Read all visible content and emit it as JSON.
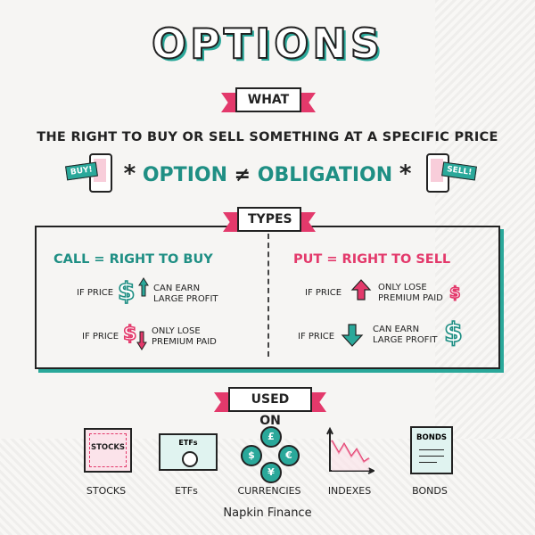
{
  "title": "OPTIONS",
  "what_ribbon": "WHAT",
  "definition": "THE RIGHT TO BUY OR SELL SOMETHING AT A SPECIFIC PRICE",
  "obligation": {
    "left": "OPTION",
    "symbol": "≠",
    "right": "OBLIGATION",
    "star": "*"
  },
  "phones": {
    "buy_tag": "BUY!",
    "sell_tag": "SELL!"
  },
  "types_ribbon": "TYPES",
  "call": {
    "heading": "CALL = RIGHT TO BUY",
    "row1": {
      "prefix": "IF PRICE",
      "dollar": "$",
      "line1": "CAN EARN",
      "line2": "LARGE PROFIT"
    },
    "row2": {
      "prefix": "IF PRICE",
      "dollar": "$",
      "line1": "ONLY LOSE",
      "line2": "PREMIUM PAID"
    }
  },
  "put": {
    "heading": "PUT = RIGHT TO SELL",
    "row1": {
      "prefix": "IF PRICE",
      "dollar": "$",
      "line1": "ONLY LOSE",
      "line2": "PREMIUM PAID"
    },
    "row2": {
      "prefix": "IF PRICE",
      "dollar": "$",
      "line1": "CAN EARN",
      "line2": "LARGE PROFIT"
    }
  },
  "used_on_ribbon": "USED ON",
  "used_on": [
    {
      "label": "STOCKS",
      "icon_text": "STOCKS",
      "icon": "stock-certificate-icon"
    },
    {
      "label": "ETFs",
      "icon_text": "ETFs",
      "icon": "etf-certificate-icon"
    },
    {
      "label": "CURRENCIES",
      "icon_text": "",
      "icon": "currency-coins-icon",
      "symbols": [
        "£",
        "$",
        "¥",
        "€"
      ]
    },
    {
      "label": "INDEXES",
      "icon_text": "",
      "icon": "index-chart-icon"
    },
    {
      "label": "BONDS",
      "icon_text": "BONDS",
      "icon": "bond-document-icon"
    }
  ],
  "brand": "Napkin Finance",
  "colors": {
    "teal": "#2aa89a",
    "pink": "#e3396b",
    "ink": "#222222"
  }
}
